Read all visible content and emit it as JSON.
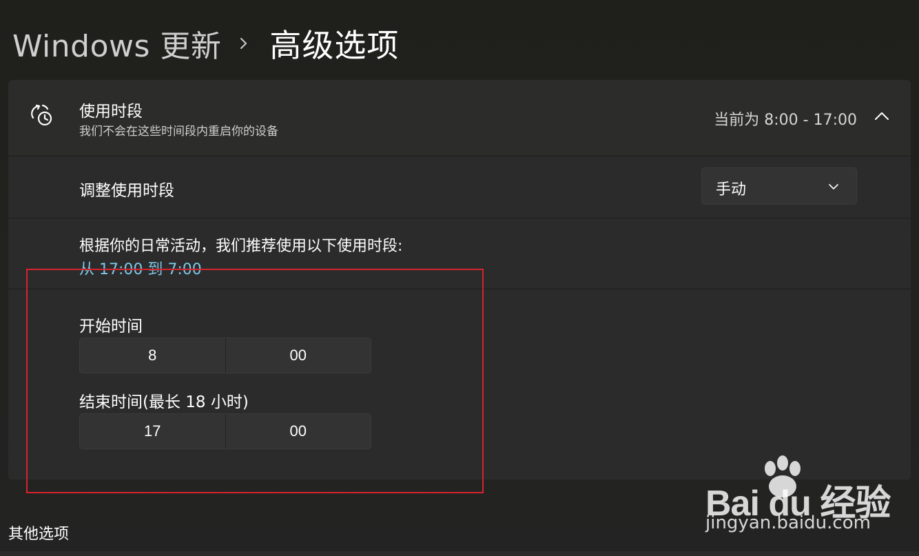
{
  "breadcrumb": {
    "parent": "Windows 更新",
    "current": "高级选项"
  },
  "active_hours": {
    "title": "使用时段",
    "subtitle": "我们不会在这些时间段内重启你的设备",
    "status": "当前为 8:00 - 17:00",
    "icon": "clock-sync-icon",
    "adjust_label": "调整使用时段",
    "mode_selected": "手动",
    "recommendation_text": "根据你的日常活动，我们推荐使用以下使用时段:",
    "recommendation_link": "从 17:00 到 7:00",
    "start_label": "开始时间",
    "start_hour": "8",
    "start_minute": "00",
    "end_label": "结束时间(最长 18 小时)",
    "end_hour": "17",
    "end_minute": "00"
  },
  "other": {
    "section_title": "其他选项"
  },
  "watermark": {
    "brand": "Bai du 经验",
    "site": "jingyan.baidu.com"
  },
  "colors": {
    "accent_link": "#7cc9e8",
    "annotation": "#d9232d",
    "card_bg": "#2b2b2b"
  }
}
